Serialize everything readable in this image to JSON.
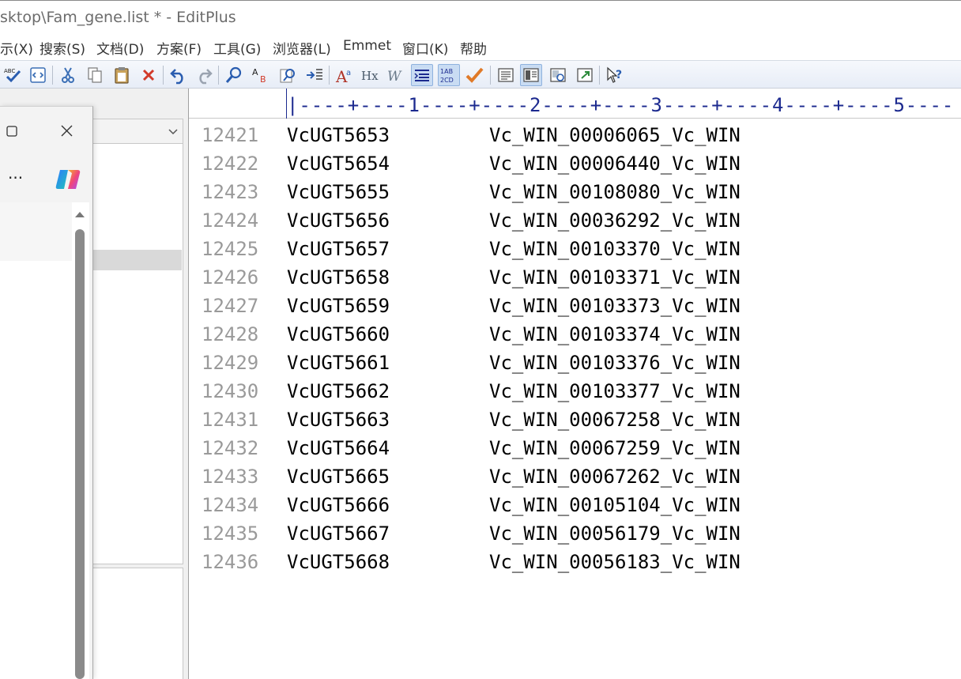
{
  "window": {
    "title": "sktop\\Fam_gene.list * - EditPlus"
  },
  "menubar": {
    "items": [
      "示(X)",
      "搜索(S)",
      "文档(D)",
      "方案(F)",
      "工具(G)",
      "浏览器(L)",
      "Emmet",
      "窗口(K)",
      "帮助"
    ]
  },
  "toolbar": {
    "icons": [
      "spell-check",
      "html-preview",
      "cut",
      "copy",
      "paste",
      "delete",
      "undo",
      "redo",
      "find",
      "replace",
      "find-in-files",
      "goto-line",
      "font",
      "hex-view",
      "word-wrap",
      "line-numbers",
      "ruler",
      "check",
      "output-window",
      "directory-window",
      "cliptext-window",
      "browser-window",
      "help"
    ],
    "active": [
      "line-numbers",
      "ruler",
      "directory-window"
    ]
  },
  "overlay_window": {
    "more_label": "···"
  },
  "ruler": {
    "text": "|----+----1----+----2----+----3----+----4----+----5----"
  },
  "editor": {
    "lines": [
      {
        "num": "12421",
        "gene": "VcUGT5653",
        "id": "Vc_WIN_00006065_Vc_WIN"
      },
      {
        "num": "12422",
        "gene": "VcUGT5654",
        "id": "Vc_WIN_00006440_Vc_WIN"
      },
      {
        "num": "12423",
        "gene": "VcUGT5655",
        "id": "Vc_WIN_00108080_Vc_WIN"
      },
      {
        "num": "12424",
        "gene": "VcUGT5656",
        "id": "Vc_WIN_00036292_Vc_WIN"
      },
      {
        "num": "12425",
        "gene": "VcUGT5657",
        "id": "Vc_WIN_00103370_Vc_WIN"
      },
      {
        "num": "12426",
        "gene": "VcUGT5658",
        "id": "Vc_WIN_00103371_Vc_WIN"
      },
      {
        "num": "12427",
        "gene": "VcUGT5659",
        "id": "Vc_WIN_00103373_Vc_WIN"
      },
      {
        "num": "12428",
        "gene": "VcUGT5660",
        "id": "Vc_WIN_00103374_Vc_WIN"
      },
      {
        "num": "12429",
        "gene": "VcUGT5661",
        "id": "Vc_WIN_00103376_Vc_WIN"
      },
      {
        "num": "12430",
        "gene": "VcUGT5662",
        "id": "Vc_WIN_00103377_Vc_WIN"
      },
      {
        "num": "12431",
        "gene": "VcUGT5663",
        "id": "Vc_WIN_00067258_Vc_WIN"
      },
      {
        "num": "12432",
        "gene": "VcUGT5664",
        "id": "Vc_WIN_00067259_Vc_WIN"
      },
      {
        "num": "12433",
        "gene": "VcUGT5665",
        "id": "Vc_WIN_00067262_Vc_WIN"
      },
      {
        "num": "12434",
        "gene": "VcUGT5666",
        "id": "Vc_WIN_00105104_Vc_WIN"
      },
      {
        "num": "12435",
        "gene": "VcUGT5667",
        "id": "Vc_WIN_00056179_Vc_WIN"
      },
      {
        "num": "12436",
        "gene": "VcUGT5668",
        "id": "Vc_WIN_00056183_Vc_WIN"
      }
    ]
  },
  "colors": {
    "line_number": "#9a9a9a",
    "ruler": "#1c2a8f",
    "text": "#000000",
    "toolbar_active": "#c9dcf3"
  }
}
